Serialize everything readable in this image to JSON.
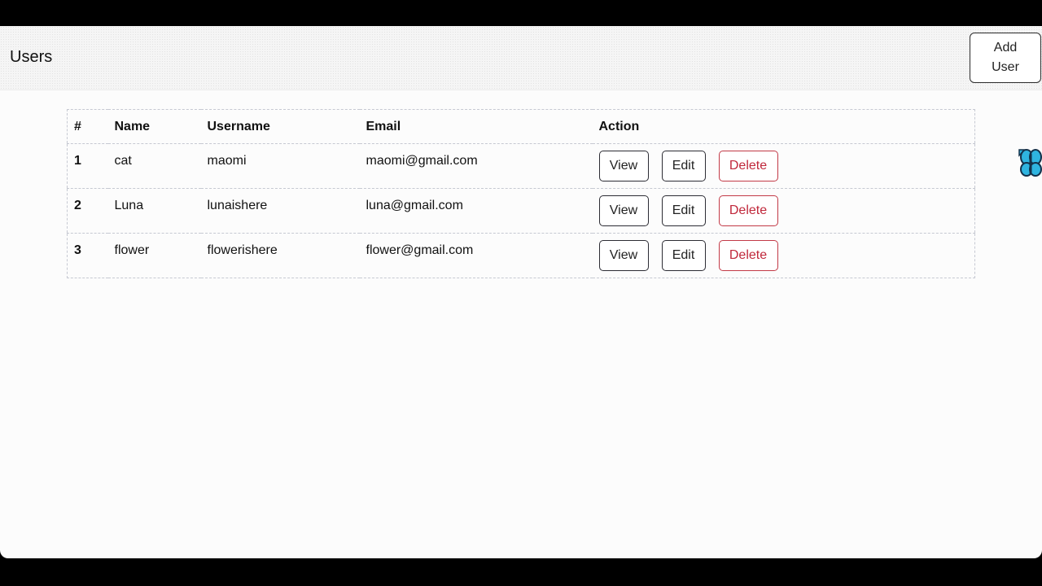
{
  "navbar": {
    "title": "Users",
    "add_button": "Add User"
  },
  "table": {
    "headers": [
      "#",
      "Name",
      "Username",
      "Email",
      "Action"
    ],
    "rows": [
      {
        "id": "1",
        "name": "cat",
        "username": "maomi",
        "email": "maomi@gmail.com"
      },
      {
        "id": "2",
        "name": "Luna",
        "username": "lunaishere",
        "email": "luna@gmail.com"
      },
      {
        "id": "3",
        "name": "flower",
        "username": "flowerishere",
        "email": "flower@gmail.com"
      }
    ],
    "actions": {
      "view": "View",
      "edit": "Edit",
      "delete": "Delete"
    }
  },
  "colors": {
    "delete_accent": "#c0283b",
    "cursor_fill": "#2fb4e0"
  }
}
